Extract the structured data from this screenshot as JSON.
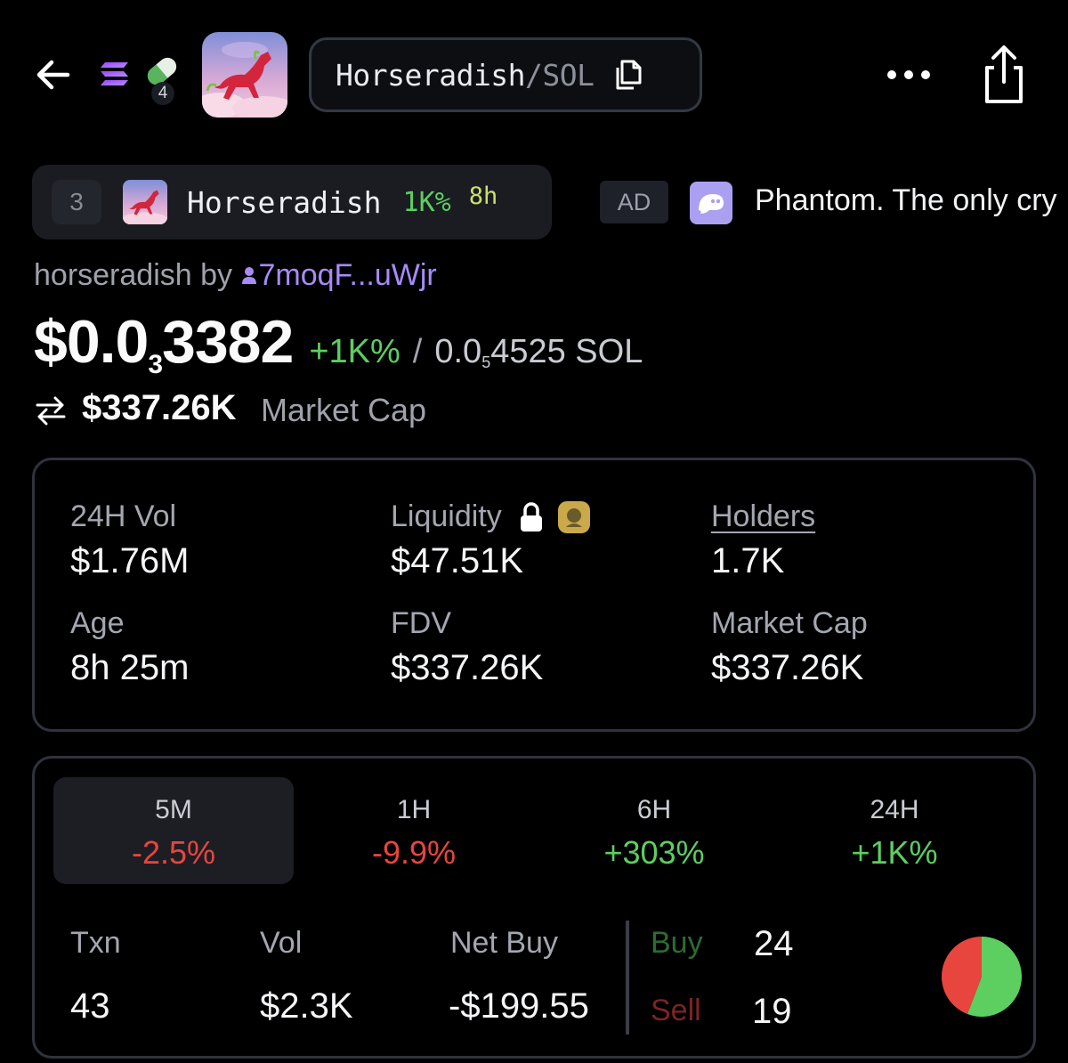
{
  "header": {
    "pair_base": "Horseradish",
    "pair_quote": "SOL",
    "pair_separator": "/",
    "badge_count": "4",
    "icons": [
      "back-arrow-icon",
      "solana-icon",
      "pill-icon",
      "copy-icon",
      "more-icon",
      "share-icon"
    ]
  },
  "trending": {
    "rank": "3",
    "name": "Horseradish",
    "change": "1K%",
    "age": "8h"
  },
  "ad": {
    "badge": "AD",
    "text": "Phantom. The only cry"
  },
  "token": {
    "byline_prefix": "horseradish by",
    "creator": "7moqF...uWjr",
    "price_lead": "$0.0",
    "price_sub": "3",
    "price_tail": "3382",
    "price_change": "+1K%",
    "price_sep": "/",
    "sol_lead": "0.0",
    "sol_sub": "5",
    "sol_tail": "4525 SOL",
    "mcap_value": "$337.26K",
    "mcap_label": "Market Cap"
  },
  "stats": {
    "vol_label": "24H Vol",
    "vol_value": "$1.76M",
    "liq_label": "Liquidity",
    "liq_value": "$47.51K",
    "holders_label": "Holders",
    "holders_value": "1.7K",
    "age_label": "Age",
    "age_value": "8h 25m",
    "fdv_label": "FDV",
    "fdv_value": "$337.26K",
    "mcap_label": "Market Cap",
    "mcap_value": "$337.26K"
  },
  "timeframes": [
    {
      "label": "5M",
      "value": "-2.5%",
      "trend": "neg",
      "active": true
    },
    {
      "label": "1H",
      "value": "-9.9%",
      "trend": "neg",
      "active": false
    },
    {
      "label": "6H",
      "value": "+303%",
      "trend": "pos",
      "active": false
    },
    {
      "label": "24H",
      "value": "+1K%",
      "trend": "pos",
      "active": false
    }
  ],
  "activity": {
    "txn_label": "Txn",
    "txn_value": "43",
    "vol_label": "Vol",
    "vol_value": "$2.3K",
    "net_label": "Net Buy",
    "net_value": "-$199.55",
    "buy_label": "Buy",
    "buy_value": "24",
    "sell_label": "Sell",
    "sell_value": "19",
    "buy_color": "#5ccf60",
    "sell_color": "#e8453f"
  }
}
